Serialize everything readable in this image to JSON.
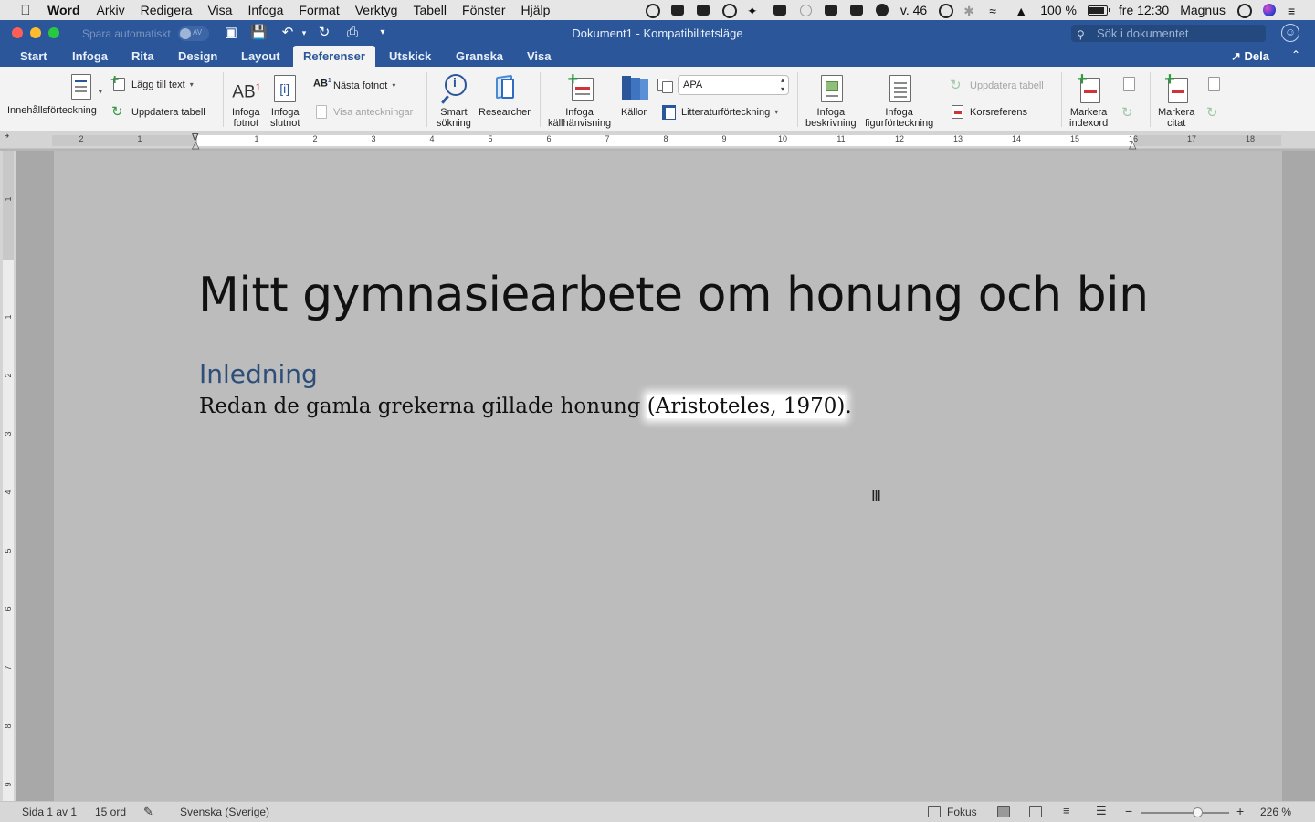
{
  "menubar": {
    "app_name": "Word",
    "items": [
      "Arkiv",
      "Redigera",
      "Visa",
      "Infoga",
      "Format",
      "Verktyg",
      "Tabell",
      "Fönster",
      "Hjälp"
    ],
    "week": "v. 46",
    "battery": "100 %",
    "clock": "fre 12:30",
    "user": "Magnus"
  },
  "titlebar": {
    "autosave_label": "Spara automatiskt",
    "autosave_state": "AV",
    "document_title": "Dokument1  -  Kompatibilitetsläge",
    "search_placeholder": "Sök i dokumentet"
  },
  "tabs": [
    "Start",
    "Infoga",
    "Rita",
    "Design",
    "Layout",
    "Referenser",
    "Utskick",
    "Granska",
    "Visa"
  ],
  "active_tab": "Referenser",
  "share_label": "Dela",
  "ribbon": {
    "toc": "Innehållsförteckning",
    "add_text": "Lägg till text",
    "update_table": "Uppdatera tabell",
    "insert_footnote": [
      "Infoga",
      "fotnot"
    ],
    "insert_endnote": [
      "Infoga",
      "slutnot"
    ],
    "next_footnote": "Nästa fotnot",
    "show_notes": "Visa anteckningar",
    "smart_lookup": [
      "Smart",
      "sökning"
    ],
    "researcher": "Researcher",
    "insert_citation": [
      "Infoga",
      "källhänvisning"
    ],
    "sources": "Källor",
    "style_value": "APA",
    "bibliography": "Litteraturförteckning",
    "insert_caption": [
      "Infoga",
      "beskrivning"
    ],
    "insert_table_of_figures": [
      "Infoga",
      "figurförteckning"
    ],
    "update_table_2": "Uppdatera tabell",
    "cross_reference": "Korsreferens",
    "mark_entry": [
      "Markera",
      "indexord"
    ],
    "mark_citation": [
      "Markera",
      "citat"
    ]
  },
  "ruler": {
    "numbers": [
      "2",
      "1",
      "1",
      "2",
      "3",
      "4",
      "5",
      "6",
      "7",
      "8",
      "9",
      "10",
      "11",
      "12",
      "13",
      "14",
      "15",
      "16",
      "17",
      "18"
    ]
  },
  "vruler": {
    "numbers": [
      "1",
      "1",
      "2",
      "3",
      "4",
      "5",
      "6",
      "7",
      "8",
      "9"
    ]
  },
  "document": {
    "heading": "Mitt gymnasiearbete om honung och bin",
    "subheading": "Inledning",
    "paragraph_text": "Redan de gamla grekerna gillade honung ",
    "citation": "(Aristoteles, 1970)",
    "paragraph_end": "."
  },
  "statusbar": {
    "page": "Sida 1 av 1",
    "words": "15 ord",
    "language": "Svenska (Sverige)",
    "focus": "Fokus",
    "zoom": "226 %"
  },
  "colors": {
    "titlebar": "#2b579a",
    "heading2": "#2e4e7a",
    "ribbon": "#f3f3f3"
  }
}
